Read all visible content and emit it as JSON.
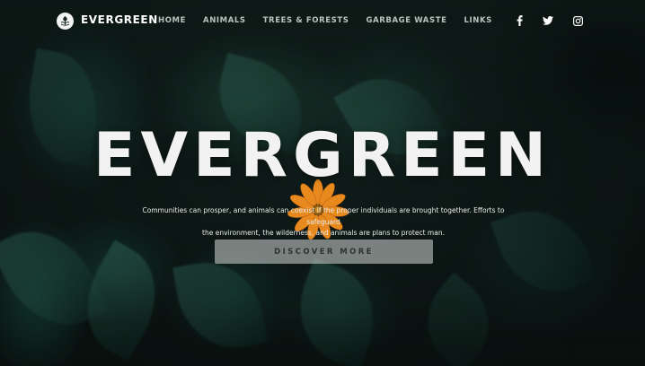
{
  "brand": {
    "name": "EVERGREEN"
  },
  "nav": {
    "links": [
      "HOME",
      "ANIMALS",
      "TREES & FORESTS",
      "GARBAGE WASTE",
      "LINKS"
    ]
  },
  "social": [
    {
      "icon": "facebook-icon",
      "glyph": "f"
    },
    {
      "icon": "twitter-icon",
      "glyph": "twitter"
    },
    {
      "icon": "instagram-icon",
      "glyph": "instagram"
    }
  ],
  "hero": {
    "headline": "EVERGREEN",
    "subtext_line1": "Communities can prosper, and animals can coexist if the proper individuals are brought together. Efforts to safeguard",
    "subtext_line2": "the environment, the wilderness, and animals are plans to protect man.",
    "cta_label": "DISCOVER MORE"
  },
  "colors": {
    "background": "#0c1513",
    "headline": "#f2f2f2",
    "flower": "#e8891e",
    "button_bg": "#bec3c1"
  }
}
